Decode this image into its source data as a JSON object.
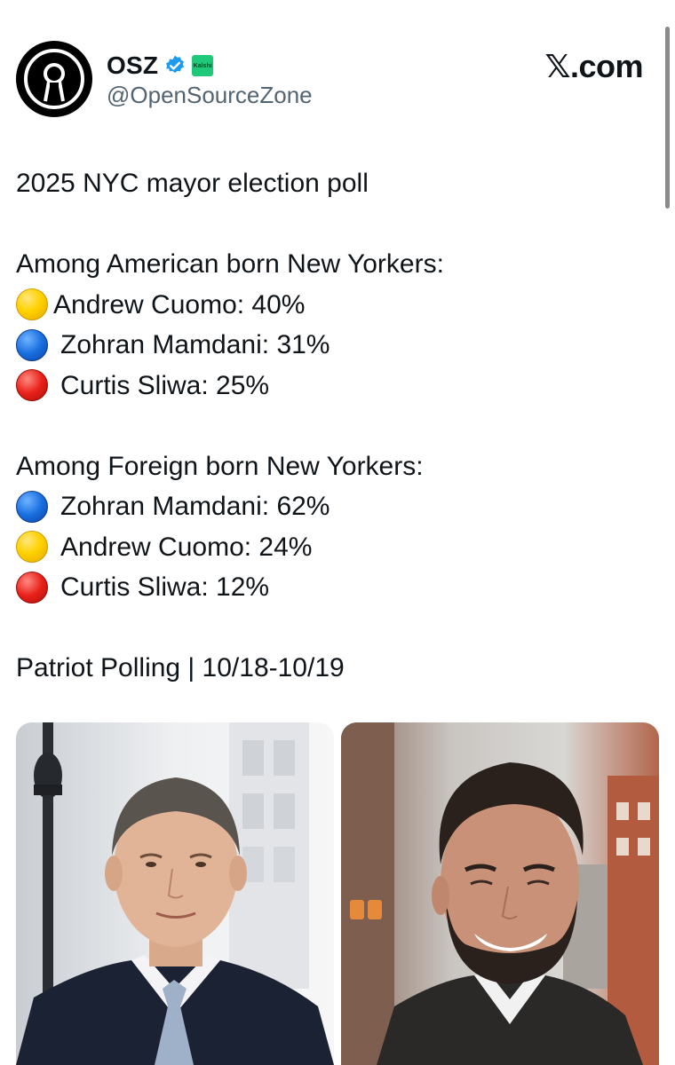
{
  "post": {
    "display_name": "OSZ",
    "handle": "@OpenSourceZone",
    "site": "𝕏.com",
    "verified_icon": "verified-badge-icon",
    "affiliate_badge": "Kalshi",
    "avatar_icon": "open-source-keyhole-logo"
  },
  "tweet": {
    "headline": "2025 NYC mayor election poll",
    "section1_title": "Among American born New Yorkers:",
    "section1": [
      {
        "color": "yellow",
        "text": "Andrew Cuomo: 40%"
      },
      {
        "color": "blue",
        "text": "Zohran Mamdani: 31%"
      },
      {
        "color": "red",
        "text": "Curtis Sliwa: 25%"
      }
    ],
    "section2_title": "Among Foreign born New Yorkers:",
    "section2": [
      {
        "color": "blue",
        "text": "Zohran Mamdani: 62%"
      },
      {
        "color": "yellow",
        "text": "Andrew Cuomo: 24%"
      },
      {
        "color": "red",
        "text": "Curtis Sliwa: 12%"
      }
    ],
    "source": "Patriot Polling | 10/18-10/19"
  },
  "colors": {
    "text": "#0f1419",
    "secondary_text": "#536471",
    "verified_blue": "#1d9bf0",
    "kalshi_green": "#20c97a",
    "yellow_circle": "#ffd200",
    "blue_circle": "#1a6fe0",
    "red_circle": "#e8211a"
  }
}
